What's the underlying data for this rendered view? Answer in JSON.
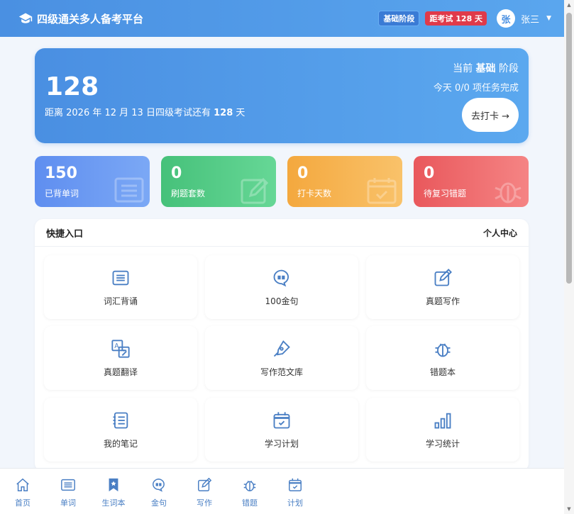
{
  "header": {
    "title": "四级通关多人备考平台",
    "stage_badge": "基础阶段",
    "countdown_badge": "距考试 128 天",
    "avatar_char": "张",
    "username": "张三"
  },
  "hero": {
    "days": "128",
    "subtitle_prefix": "距离 2026 年 12 月 13 日四级考试还有 ",
    "subtitle_days": "128",
    "subtitle_suffix": " 天",
    "stage_prefix": "当前 ",
    "stage_name": "基础",
    "stage_suffix": " 阶段",
    "task_progress": "今天 0/0 项任务完成",
    "checkin_label": "去打卡 →"
  },
  "stats": [
    {
      "value": "150",
      "label": "已背单词"
    },
    {
      "value": "0",
      "label": "刷题套数"
    },
    {
      "value": "0",
      "label": "打卡天数"
    },
    {
      "value": "0",
      "label": "待复习错题"
    }
  ],
  "quick": {
    "title": "快捷入口",
    "link": "个人中心",
    "tiles": [
      {
        "label": "词汇背诵",
        "icon": "list-icon"
      },
      {
        "label": "100金句",
        "icon": "quote-icon"
      },
      {
        "label": "真题写作",
        "icon": "edit-icon"
      },
      {
        "label": "真题翻译",
        "icon": "translate-icon"
      },
      {
        "label": "写作范文库",
        "icon": "pen-icon"
      },
      {
        "label": "错题本",
        "icon": "bug-icon"
      },
      {
        "label": "我的笔记",
        "icon": "notes-icon"
      },
      {
        "label": "学习计划",
        "icon": "calendar-icon"
      },
      {
        "label": "学习统计",
        "icon": "bar-chart-icon"
      }
    ]
  },
  "nav": [
    {
      "label": "首页",
      "icon": "home-icon"
    },
    {
      "label": "单词",
      "icon": "list-icon"
    },
    {
      "label": "生词本",
      "icon": "bookmark-icon"
    },
    {
      "label": "金句",
      "icon": "quote-icon"
    },
    {
      "label": "写作",
      "icon": "edit-icon"
    },
    {
      "label": "错题",
      "icon": "bug-icon"
    },
    {
      "label": "计划",
      "icon": "calendar-icon"
    }
  ],
  "colors": {
    "accent": "#4a90e2",
    "countdown_badge": "#e03a4a",
    "stat_words": "#5f8ef0",
    "stat_exams": "#46c17a",
    "stat_checkin": "#f4a83e",
    "stat_mistakes": "#e9585c"
  }
}
